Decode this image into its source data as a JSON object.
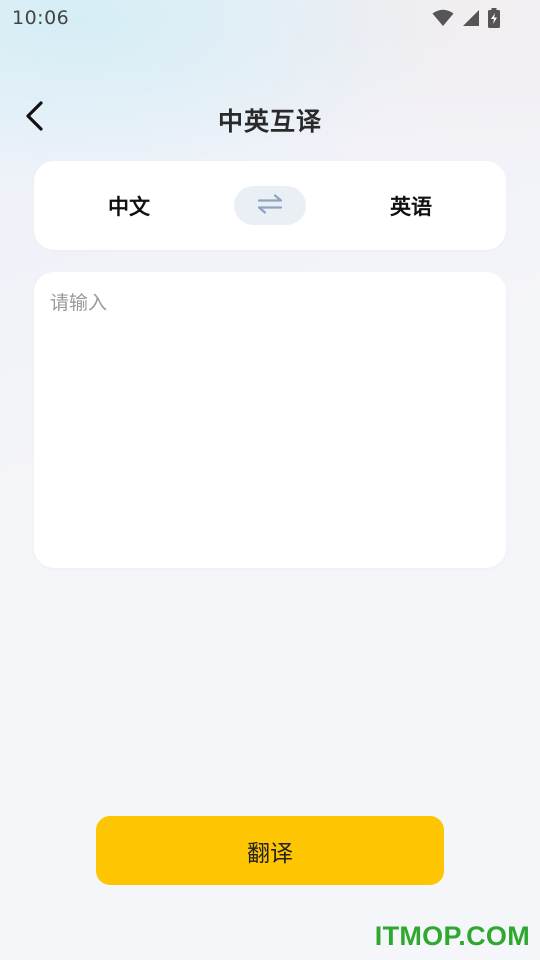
{
  "status_bar": {
    "time": "10:06",
    "icons": [
      "wifi-icon",
      "cellular-signal-icon",
      "battery-charging-icon"
    ]
  },
  "header": {
    "title": "中英互译",
    "back_icon": "chevron-left-icon"
  },
  "language_selector": {
    "source": "中文",
    "target": "英语",
    "swap_icon": "swap-arrows-icon"
  },
  "input": {
    "placeholder": "请输入",
    "value": ""
  },
  "actions": {
    "translate_label": "翻译"
  },
  "watermark": {
    "text": "ITMOP.COM"
  },
  "colors": {
    "accent": "#fec602",
    "watermark": "#2ea82e",
    "swap_bg": "#eaeff6",
    "swap_icon": "#8fa3c0"
  }
}
